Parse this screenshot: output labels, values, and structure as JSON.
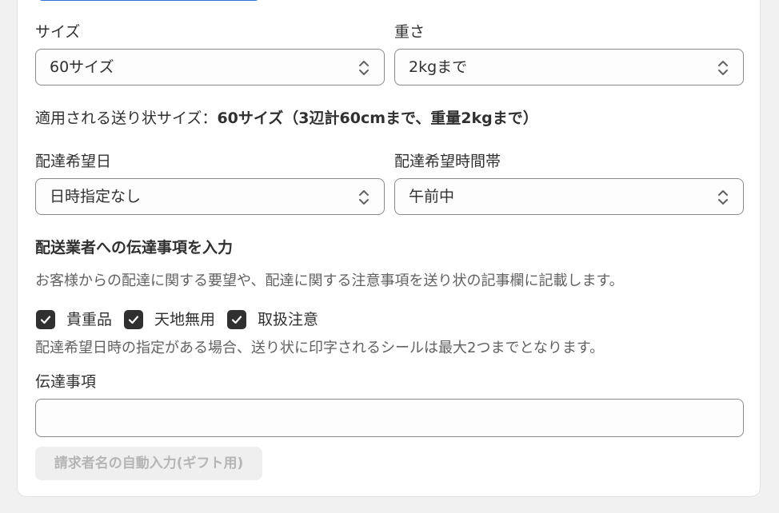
{
  "shipping": {
    "size_label": "サイズ",
    "size_value": "60サイズ",
    "weight_label": "重さ",
    "weight_value": "2kgまで",
    "applied_prefix": "適用される送り状サイズ：",
    "applied_value": "60サイズ（3辺計60cmまで、重量2kgまで）",
    "date_label": "配達希望日",
    "date_value": "日時指定なし",
    "time_label": "配達希望時間帯",
    "time_value": "午前中"
  },
  "instructions": {
    "title": "配送業者への伝達事項を入力",
    "description": "お客様からの配達に関する要望や、配達に関する注意事項を送り状の記事欄に記載します。",
    "checkboxes": [
      {
        "label": "貴重品",
        "checked": true
      },
      {
        "label": "天地無用",
        "checked": true
      },
      {
        "label": "取扱注意",
        "checked": true
      }
    ],
    "note": "配達希望日時の指定がある場合、送り状に印字されるシールは最大2つまでとなります。",
    "message_label": "伝達事項",
    "message_value": "",
    "autofill_button": "請求者名の自動入力(ギフト用)"
  },
  "colors": {
    "background": "#f1f1f1",
    "card": "#ffffff",
    "checkbox": "#303030",
    "accent": "#2f6fd6",
    "disabled_text": "#b5b5b5"
  },
  "icons": {
    "select": "chevron-up-down-icon",
    "checkbox": "checkmark-icon"
  }
}
